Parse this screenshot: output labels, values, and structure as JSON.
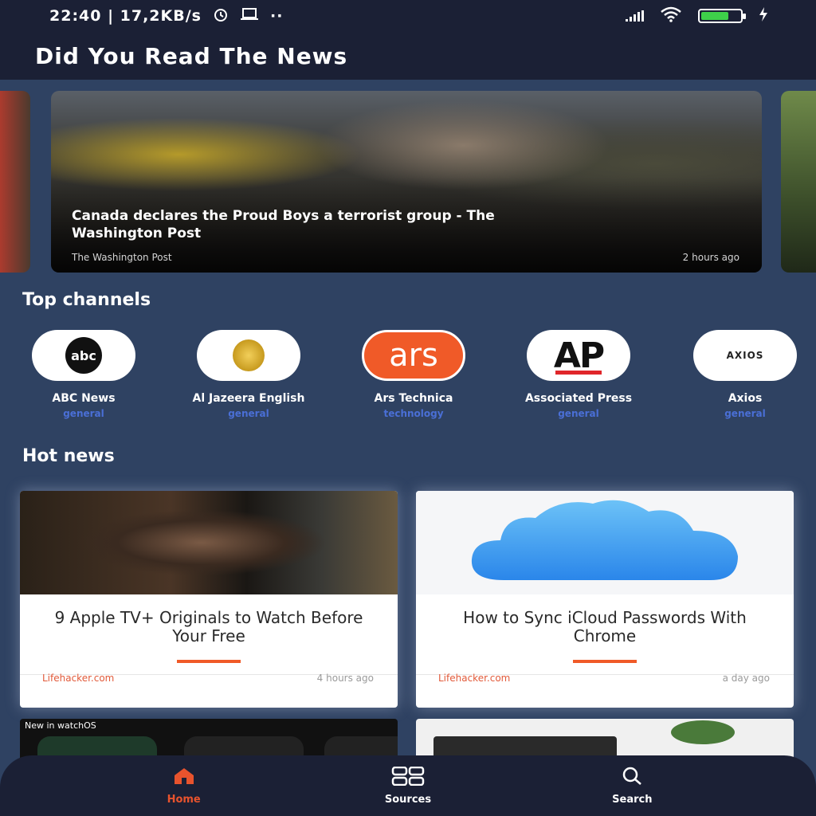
{
  "status_bar": {
    "time_speed": "22:40 | 17,2KB/s",
    "dots": "··",
    "battery_level": 0.7
  },
  "header": {
    "title": "Did You Read The News"
  },
  "carousel": {
    "main": {
      "headline": "Canada declares the Proud Boys a terrorist group - The Washington Post",
      "source": "The Washington Post",
      "time": "2 hours ago"
    }
  },
  "top_channels": {
    "title": "Top channels",
    "items": [
      {
        "name": "ABC News",
        "category": "general",
        "logo_text": "abc"
      },
      {
        "name": "Al Jazeera English",
        "category": "general",
        "logo_text": ""
      },
      {
        "name": "Ars Technica",
        "category": "technology",
        "logo_text": "ars"
      },
      {
        "name": "Associated Press",
        "category": "general",
        "logo_text": "AP"
      },
      {
        "name": "Axios",
        "category": "general",
        "logo_text": "AXIOS"
      }
    ]
  },
  "hot_news": {
    "title": "Hot news",
    "cards": [
      {
        "title": "9 Apple TV+ Originals to Watch Before Your Free",
        "source": "Lifehacker.com",
        "time": "4 hours ago"
      },
      {
        "title": "How to Sync iCloud Passwords With Chrome",
        "source": "Lifehacker.com",
        "time": "a day ago"
      }
    ],
    "partial_card_caption": "New in watchOS"
  },
  "bottom_nav": {
    "items": [
      {
        "label": "Home",
        "icon": "home-icon",
        "active": true
      },
      {
        "label": "Sources",
        "icon": "sources-icon",
        "active": false
      },
      {
        "label": "Search",
        "icon": "search-icon",
        "active": false
      }
    ]
  },
  "colors": {
    "background": "#2f4262",
    "header": "#1b2035",
    "accent": "#e8532d",
    "category": "#4a6fd6"
  }
}
